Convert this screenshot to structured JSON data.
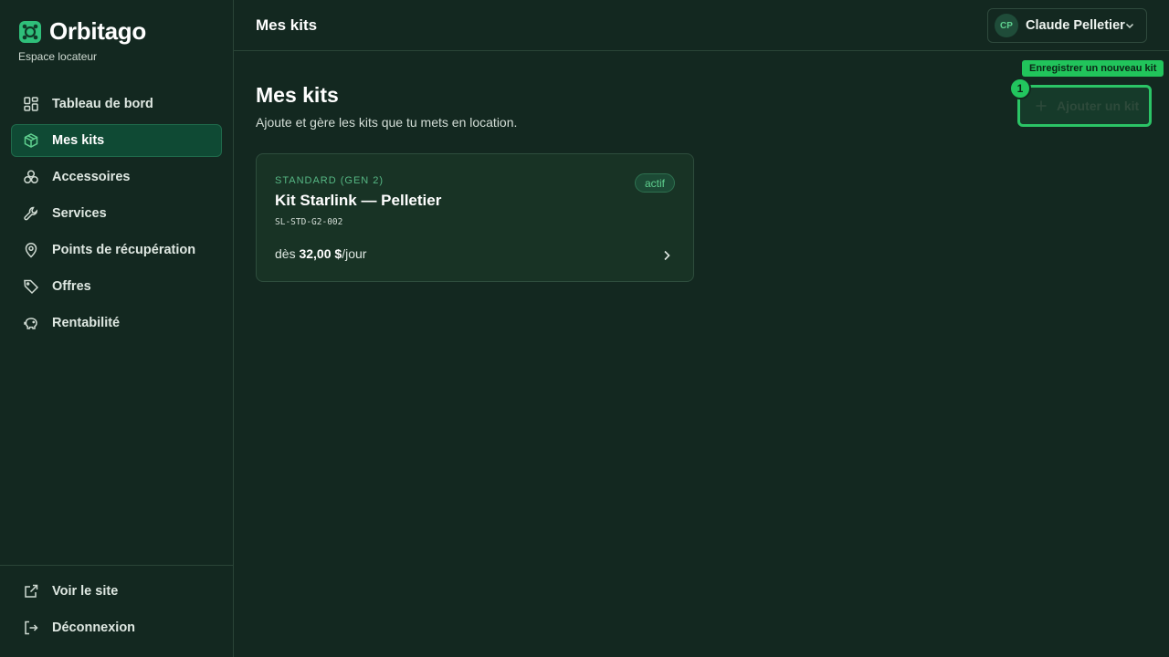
{
  "brand": {
    "name": "Orbitago",
    "subtitle": "Espace locateur"
  },
  "sidebar": {
    "items": [
      {
        "label": "Tableau de bord",
        "icon": "dashboard-icon"
      },
      {
        "label": "Mes kits",
        "icon": "box-icon",
        "active": true
      },
      {
        "label": "Accessoires",
        "icon": "accessories-icon"
      },
      {
        "label": "Services",
        "icon": "wrench-icon"
      },
      {
        "label": "Points de récupération",
        "icon": "map-pin-icon"
      },
      {
        "label": "Offres",
        "icon": "tag-icon"
      },
      {
        "label": "Rentabilité",
        "icon": "piggy-bank-icon"
      }
    ],
    "bottom": [
      {
        "label": "Voir le site",
        "icon": "external-link-icon"
      },
      {
        "label": "Déconnexion",
        "icon": "logout-icon"
      }
    ]
  },
  "topbar": {
    "title": "Mes kits",
    "user_initials": "CP",
    "user_name": "Claude Pelletier"
  },
  "main": {
    "title": "Mes kits",
    "subtitle": "Ajoute et gère les kits que tu mets en location.",
    "add_button": "Ajouter un kit",
    "tooltip": "Enregistrer un nouveau kit",
    "step_number": "1"
  },
  "kits": [
    {
      "category": "STANDARD (GEN 2)",
      "title": "Kit Starlink — Pelletier",
      "code": "SL-STD-G2-002",
      "status": "actif",
      "price_prefix": "dès ",
      "price_value": "32,00 $",
      "price_suffix": "/jour"
    }
  ],
  "colors": {
    "accent": "#22c55e",
    "background": "#132820",
    "active_nav": "#0f4a34"
  }
}
